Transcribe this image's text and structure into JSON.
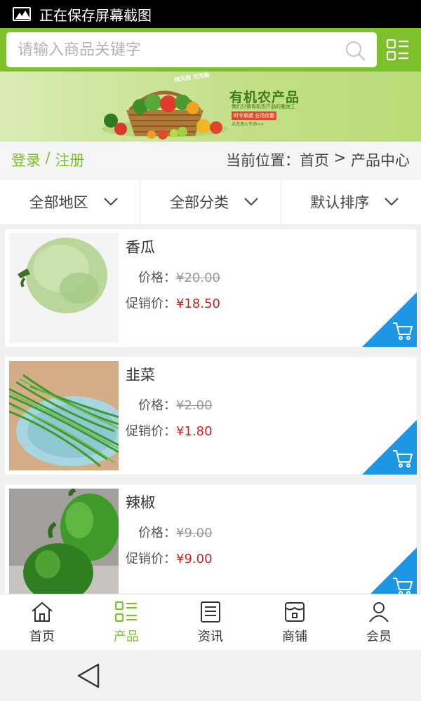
{
  "status_bar": {
    "text": "正在保存屏幕截图",
    "icon": "image-icon"
  },
  "search": {
    "placeholder": "请输入商品关键字",
    "icon": "search-icon"
  },
  "menu_icon": "grid-list-icon",
  "banner": {
    "title": "有机农产品",
    "subtitle": "我们只做有机农产品的搬运工",
    "tag": "时令果蔬  全场优惠",
    "note": "点击进入专场>>",
    "small": "纯天然 无污染"
  },
  "login": {
    "login": "登录",
    "sep": " / ",
    "register": "注册"
  },
  "breadcrumb": {
    "label": "当前位置：",
    "home": "首页",
    "sep": " > ",
    "current": "产品中心"
  },
  "filters": [
    {
      "label": "全部地区",
      "icon": "chevron-down-icon"
    },
    {
      "label": "全部分类",
      "icon": "chevron-down-icon"
    },
    {
      "label": "默认排序",
      "icon": "chevron-down-icon"
    }
  ],
  "price_label": "价格：",
  "promo_label": "促销价：",
  "products": [
    {
      "name": "香瓜",
      "price": "¥20.00",
      "promo": "¥18.50",
      "image": "melon"
    },
    {
      "name": "韭菜",
      "price": "¥2.00",
      "promo": "¥1.80",
      "image": "chives"
    },
    {
      "name": "辣椒",
      "price": "¥9.00",
      "promo": "¥9.00",
      "image": "green-pepper"
    }
  ],
  "tabs": [
    {
      "label": "首页",
      "icon": "home-icon",
      "active": false
    },
    {
      "label": "产品",
      "icon": "product-list-icon",
      "active": true
    },
    {
      "label": "资讯",
      "icon": "news-icon",
      "active": false
    },
    {
      "label": "商铺",
      "icon": "store-icon",
      "active": false
    },
    {
      "label": "会员",
      "icon": "user-icon",
      "active": false
    }
  ],
  "colors": {
    "accent": "#7cc12c",
    "promo": "#d31e1e",
    "cart_corner": "#1e96e6"
  }
}
